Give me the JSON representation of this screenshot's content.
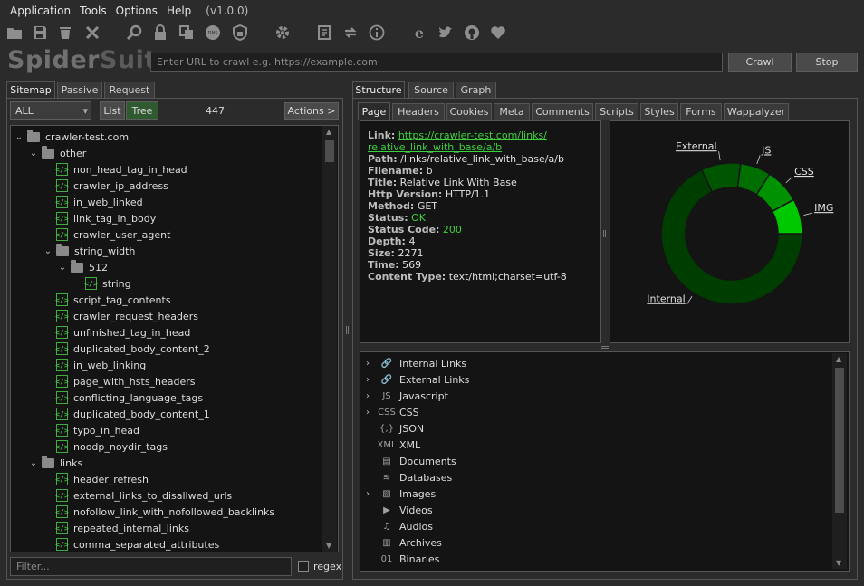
{
  "menu": {
    "items": [
      "Application",
      "Tools",
      "Options",
      "Help"
    ],
    "version": "(v1.0.0)"
  },
  "logo": {
    "part1": "Spider",
    "part2": "Suite"
  },
  "url_bar": {
    "placeholder": "Enter URL to crawl e.g. https://example.com",
    "crawl_label": "Crawl",
    "stop_label": "Stop"
  },
  "left": {
    "tabs": [
      "Sitemap",
      "Passive",
      "Request"
    ],
    "filter_select": "ALL",
    "view_list": "List",
    "view_tree": "Tree",
    "count": "447",
    "actions_label": "Actions >",
    "tree": [
      {
        "label": "crawler-test.com",
        "type": "folder",
        "depth": 0,
        "expanded": true
      },
      {
        "label": "other",
        "type": "folder",
        "depth": 1,
        "expanded": true
      },
      {
        "label": "non_head_tag_in_head",
        "type": "file",
        "depth": 2
      },
      {
        "label": "crawler_ip_address",
        "type": "file",
        "depth": 2
      },
      {
        "label": "in_web_linked",
        "type": "file",
        "depth": 2
      },
      {
        "label": "link_tag_in_body",
        "type": "file",
        "depth": 2
      },
      {
        "label": "crawler_user_agent",
        "type": "file",
        "depth": 2
      },
      {
        "label": "string_width",
        "type": "folder",
        "depth": 2,
        "expanded": true
      },
      {
        "label": "512",
        "type": "folder",
        "depth": 3,
        "expanded": true
      },
      {
        "label": "string",
        "type": "file",
        "depth": 4
      },
      {
        "label": "script_tag_contents",
        "type": "file",
        "depth": 2
      },
      {
        "label": "crawler_request_headers",
        "type": "file",
        "depth": 2
      },
      {
        "label": "unfinished_tag_in_head",
        "type": "file",
        "depth": 2
      },
      {
        "label": "duplicated_body_content_2",
        "type": "file",
        "depth": 2
      },
      {
        "label": "in_web_linking",
        "type": "file",
        "depth": 2
      },
      {
        "label": "page_with_hsts_headers",
        "type": "file",
        "depth": 2
      },
      {
        "label": "conflicting_language_tags",
        "type": "file",
        "depth": 2
      },
      {
        "label": "duplicated_body_content_1",
        "type": "file",
        "depth": 2
      },
      {
        "label": "typo_in_head",
        "type": "file",
        "depth": 2
      },
      {
        "label": "noodp_noydir_tags",
        "type": "file",
        "depth": 2
      },
      {
        "label": "links",
        "type": "folder",
        "depth": 1,
        "expanded": true
      },
      {
        "label": "header_refresh",
        "type": "file",
        "depth": 2
      },
      {
        "label": "external_links_to_disallwed_urls",
        "type": "file",
        "depth": 2
      },
      {
        "label": "nofollow_link_with_nofollowed_backlinks",
        "type": "file",
        "depth": 2
      },
      {
        "label": "repeated_internal_links",
        "type": "file",
        "depth": 2
      },
      {
        "label": "comma_separated_attributes",
        "type": "file",
        "depth": 2
      }
    ],
    "filter_placeholder": "Filter...",
    "regex_label": "regex"
  },
  "right": {
    "tabs": [
      "Structure",
      "Source",
      "Graph"
    ],
    "subtabs": [
      "Page",
      "Headers",
      "Cookies",
      "Meta",
      "Comments",
      "Scripts",
      "Styles",
      "Forms",
      "Wappalyzer"
    ],
    "info": {
      "link_key": "Link:",
      "link_value_1": "https://crawler-test.com/links/",
      "link_value_2": "relative_link_with_base/a/b",
      "rows": [
        {
          "key": "Path:",
          "value": "/links/relative_link_with_base/a/b"
        },
        {
          "key": "Filename:",
          "value": "b"
        },
        {
          "key": "Title:",
          "value": "Relative Link With Base"
        },
        {
          "key": "Http Version:",
          "value": "HTTP/1.1"
        },
        {
          "key": "Method:",
          "value": "GET"
        },
        {
          "key": "Status:",
          "value": "OK"
        },
        {
          "key": "Status Code:",
          "value": "200"
        },
        {
          "key": "Depth:",
          "value": "4"
        },
        {
          "key": "Size:",
          "value": "2271"
        },
        {
          "key": "Time:",
          "value": "569"
        },
        {
          "key": "Content Type:",
          "value": "text/html;charset=utf-8"
        }
      ]
    },
    "resources": [
      {
        "label": "Internal Links",
        "icon": "link-icon",
        "expandable": true
      },
      {
        "label": "External Links",
        "icon": "link-icon",
        "expandable": true
      },
      {
        "label": "Javascript",
        "icon": "js-icon",
        "expandable": true
      },
      {
        "label": "CSS",
        "icon": "css-icon",
        "expandable": true
      },
      {
        "label": "JSON",
        "icon": "json-icon",
        "expandable": false
      },
      {
        "label": "XML",
        "icon": "xml-icon",
        "expandable": false
      },
      {
        "label": "Documents",
        "icon": "document-icon",
        "expandable": false
      },
      {
        "label": "Databases",
        "icon": "database-icon",
        "expandable": false
      },
      {
        "label": "Images",
        "icon": "image-icon",
        "expandable": true
      },
      {
        "label": "Videos",
        "icon": "video-icon",
        "expandable": false
      },
      {
        "label": "Audios",
        "icon": "music-icon",
        "expandable": false
      },
      {
        "label": "Archives",
        "icon": "archive-icon",
        "expandable": false
      },
      {
        "label": "Binaries",
        "icon": "binary-icon",
        "expandable": false
      }
    ]
  },
  "chart_data": {
    "type": "pie",
    "title": "",
    "donut": true,
    "categories": [
      "Internal",
      "External",
      "JS",
      "CSS",
      "IMG"
    ],
    "values": [
      68,
      9,
      7,
      8,
      8
    ],
    "colors": [
      "#003d00",
      "#005500",
      "#006e00",
      "#009100",
      "#00c800"
    ],
    "legend": "labels-with-leaders"
  },
  "colors": {
    "green_link": "#3fd03f",
    "status_green": "#3fd03f",
    "bg": "#2b2b2b",
    "panel": "#141414"
  }
}
